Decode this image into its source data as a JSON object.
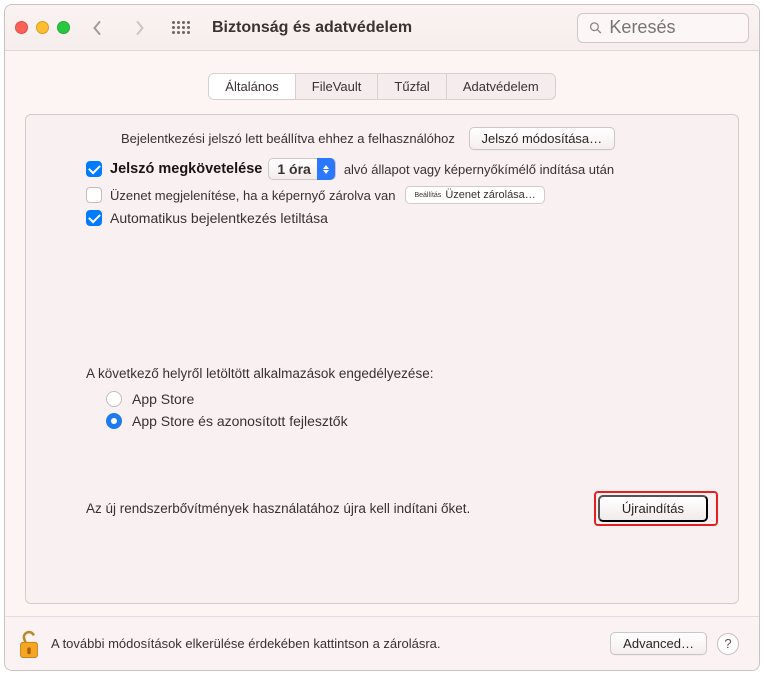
{
  "header": {
    "title": "Biztonság és adatvédelem",
    "search_placeholder": "Keresés"
  },
  "tabs": [
    {
      "label": "Általános",
      "active": true
    },
    {
      "label": "FileVault",
      "active": false
    },
    {
      "label": "Tűzfal",
      "active": false
    },
    {
      "label": "Adatvédelem",
      "active": false
    }
  ],
  "general": {
    "login_password_set": "Bejelentkezési jelszó lett beállítva ehhez a felhasználóhoz",
    "change_password": "Jelszó módosítása…",
    "require_password_prefix": "Jelszó megkövetelése",
    "require_password_delay": "1 óra",
    "require_password_suffix": "alvó állapot vagy képernyőkímélő indítása után",
    "show_message": "Üzenet megjelenítése, ha a képernyő zárolva van",
    "set_lock_prefix": "Beállítás",
    "set_lock_message": "Üzenet zárolása…",
    "disable_auto_login": "Automatikus bejelentkezés letiltása"
  },
  "apps": {
    "title": "A következő helyről letöltött alkalmazások engedélyezése:",
    "option_appstore": "App Store",
    "option_identified": "App Store és azonosított fejlesztők"
  },
  "extensions": {
    "message": "Az új rendszerbővítmények használatához újra kell indítani őket.",
    "restart": "Újraindítás"
  },
  "footer": {
    "lock_text": "A további módosítások elkerülése érdekében kattintson a zárolásra.",
    "advanced": "Advanced…",
    "help": "?"
  }
}
